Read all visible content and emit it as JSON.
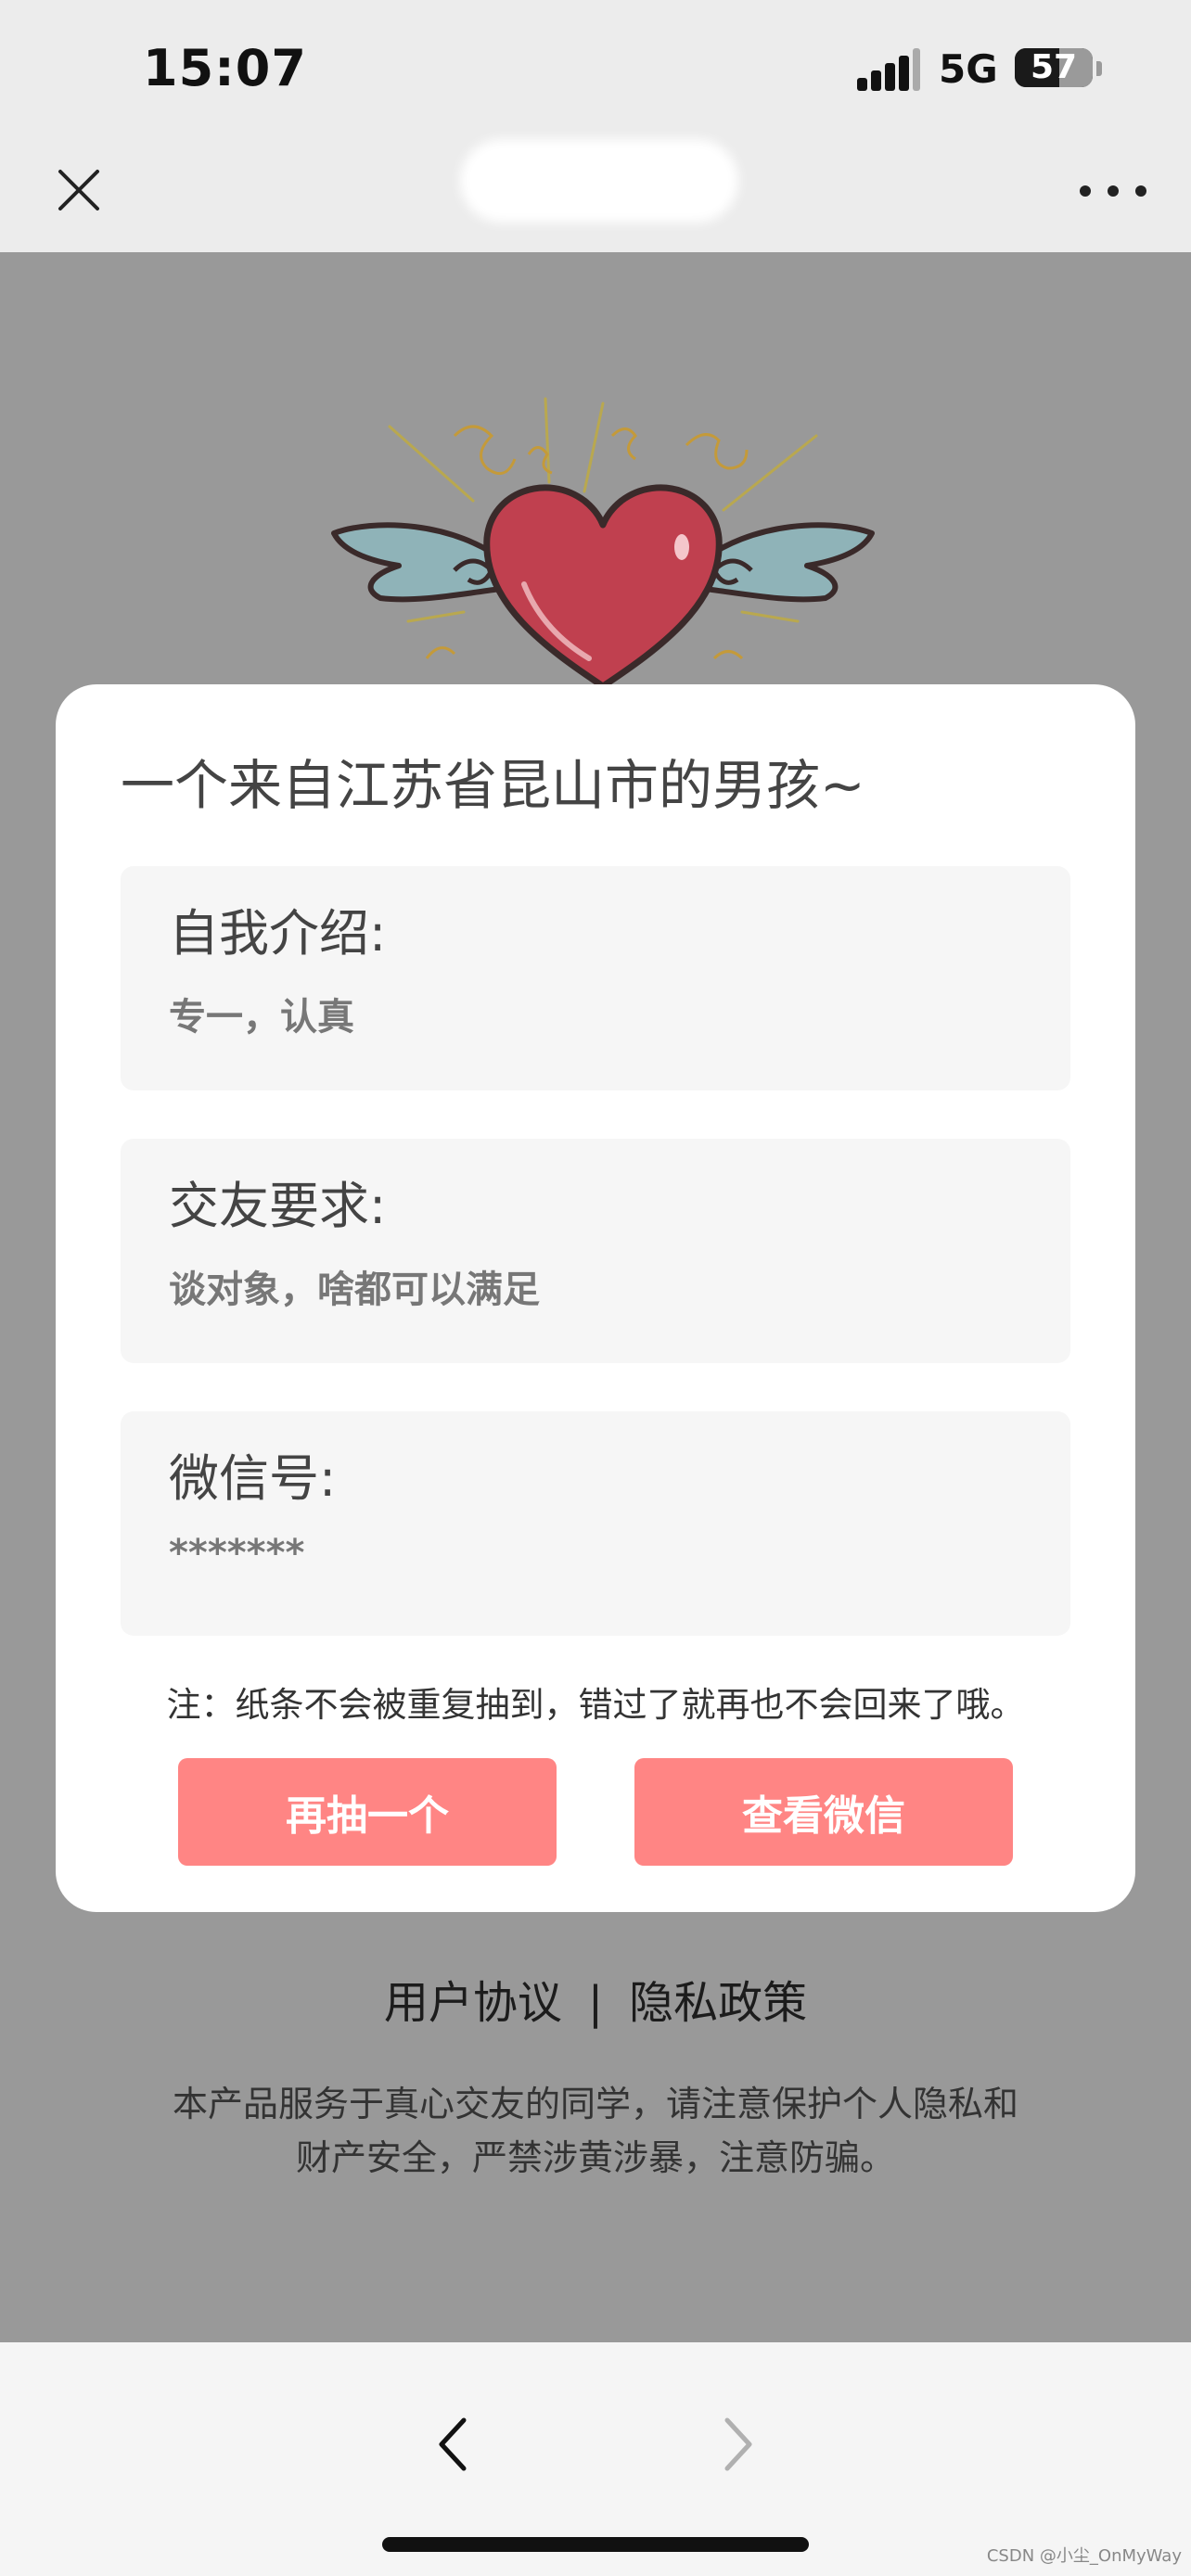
{
  "status_bar": {
    "time": "15:07",
    "network": "5G",
    "battery": "57",
    "battery_level_percent": 57
  },
  "header": {
    "close_icon": "close-icon",
    "more_icon": "more-dots-icon"
  },
  "card": {
    "title": "一个来自江苏省昆山市的男孩~",
    "sections": [
      {
        "label": "自我介绍:",
        "value": "专一，认真"
      },
      {
        "label": "交友要求:",
        "value": "谈对象，啥都可以满足"
      },
      {
        "label": "微信号:",
        "value": "*******"
      }
    ],
    "note": "注：纸条不会被重复抽到，错过了就再也不会回来了哦。",
    "buttons": {
      "redraw": "再抽一个",
      "view_wechat": "查看微信"
    }
  },
  "footer": {
    "user_agreement": "用户协议",
    "separator": "|",
    "privacy_policy": "隐私政策",
    "disclaimer": "本产品服务于真心交友的同学，请注意保护个人隐私和财产安全，严禁涉黄涉暴，注意防骗。"
  },
  "bottom_nav": {
    "back_icon": "chevron-left-icon",
    "forward_icon": "chevron-right-icon"
  },
  "watermark": "CSDN @小尘_OnMyWay",
  "colors": {
    "accent_button": "#ff8584",
    "overlay_background": "#999999",
    "card_background": "#ffffff",
    "heart": "#c0404f",
    "wing": "#8fb3b8"
  }
}
